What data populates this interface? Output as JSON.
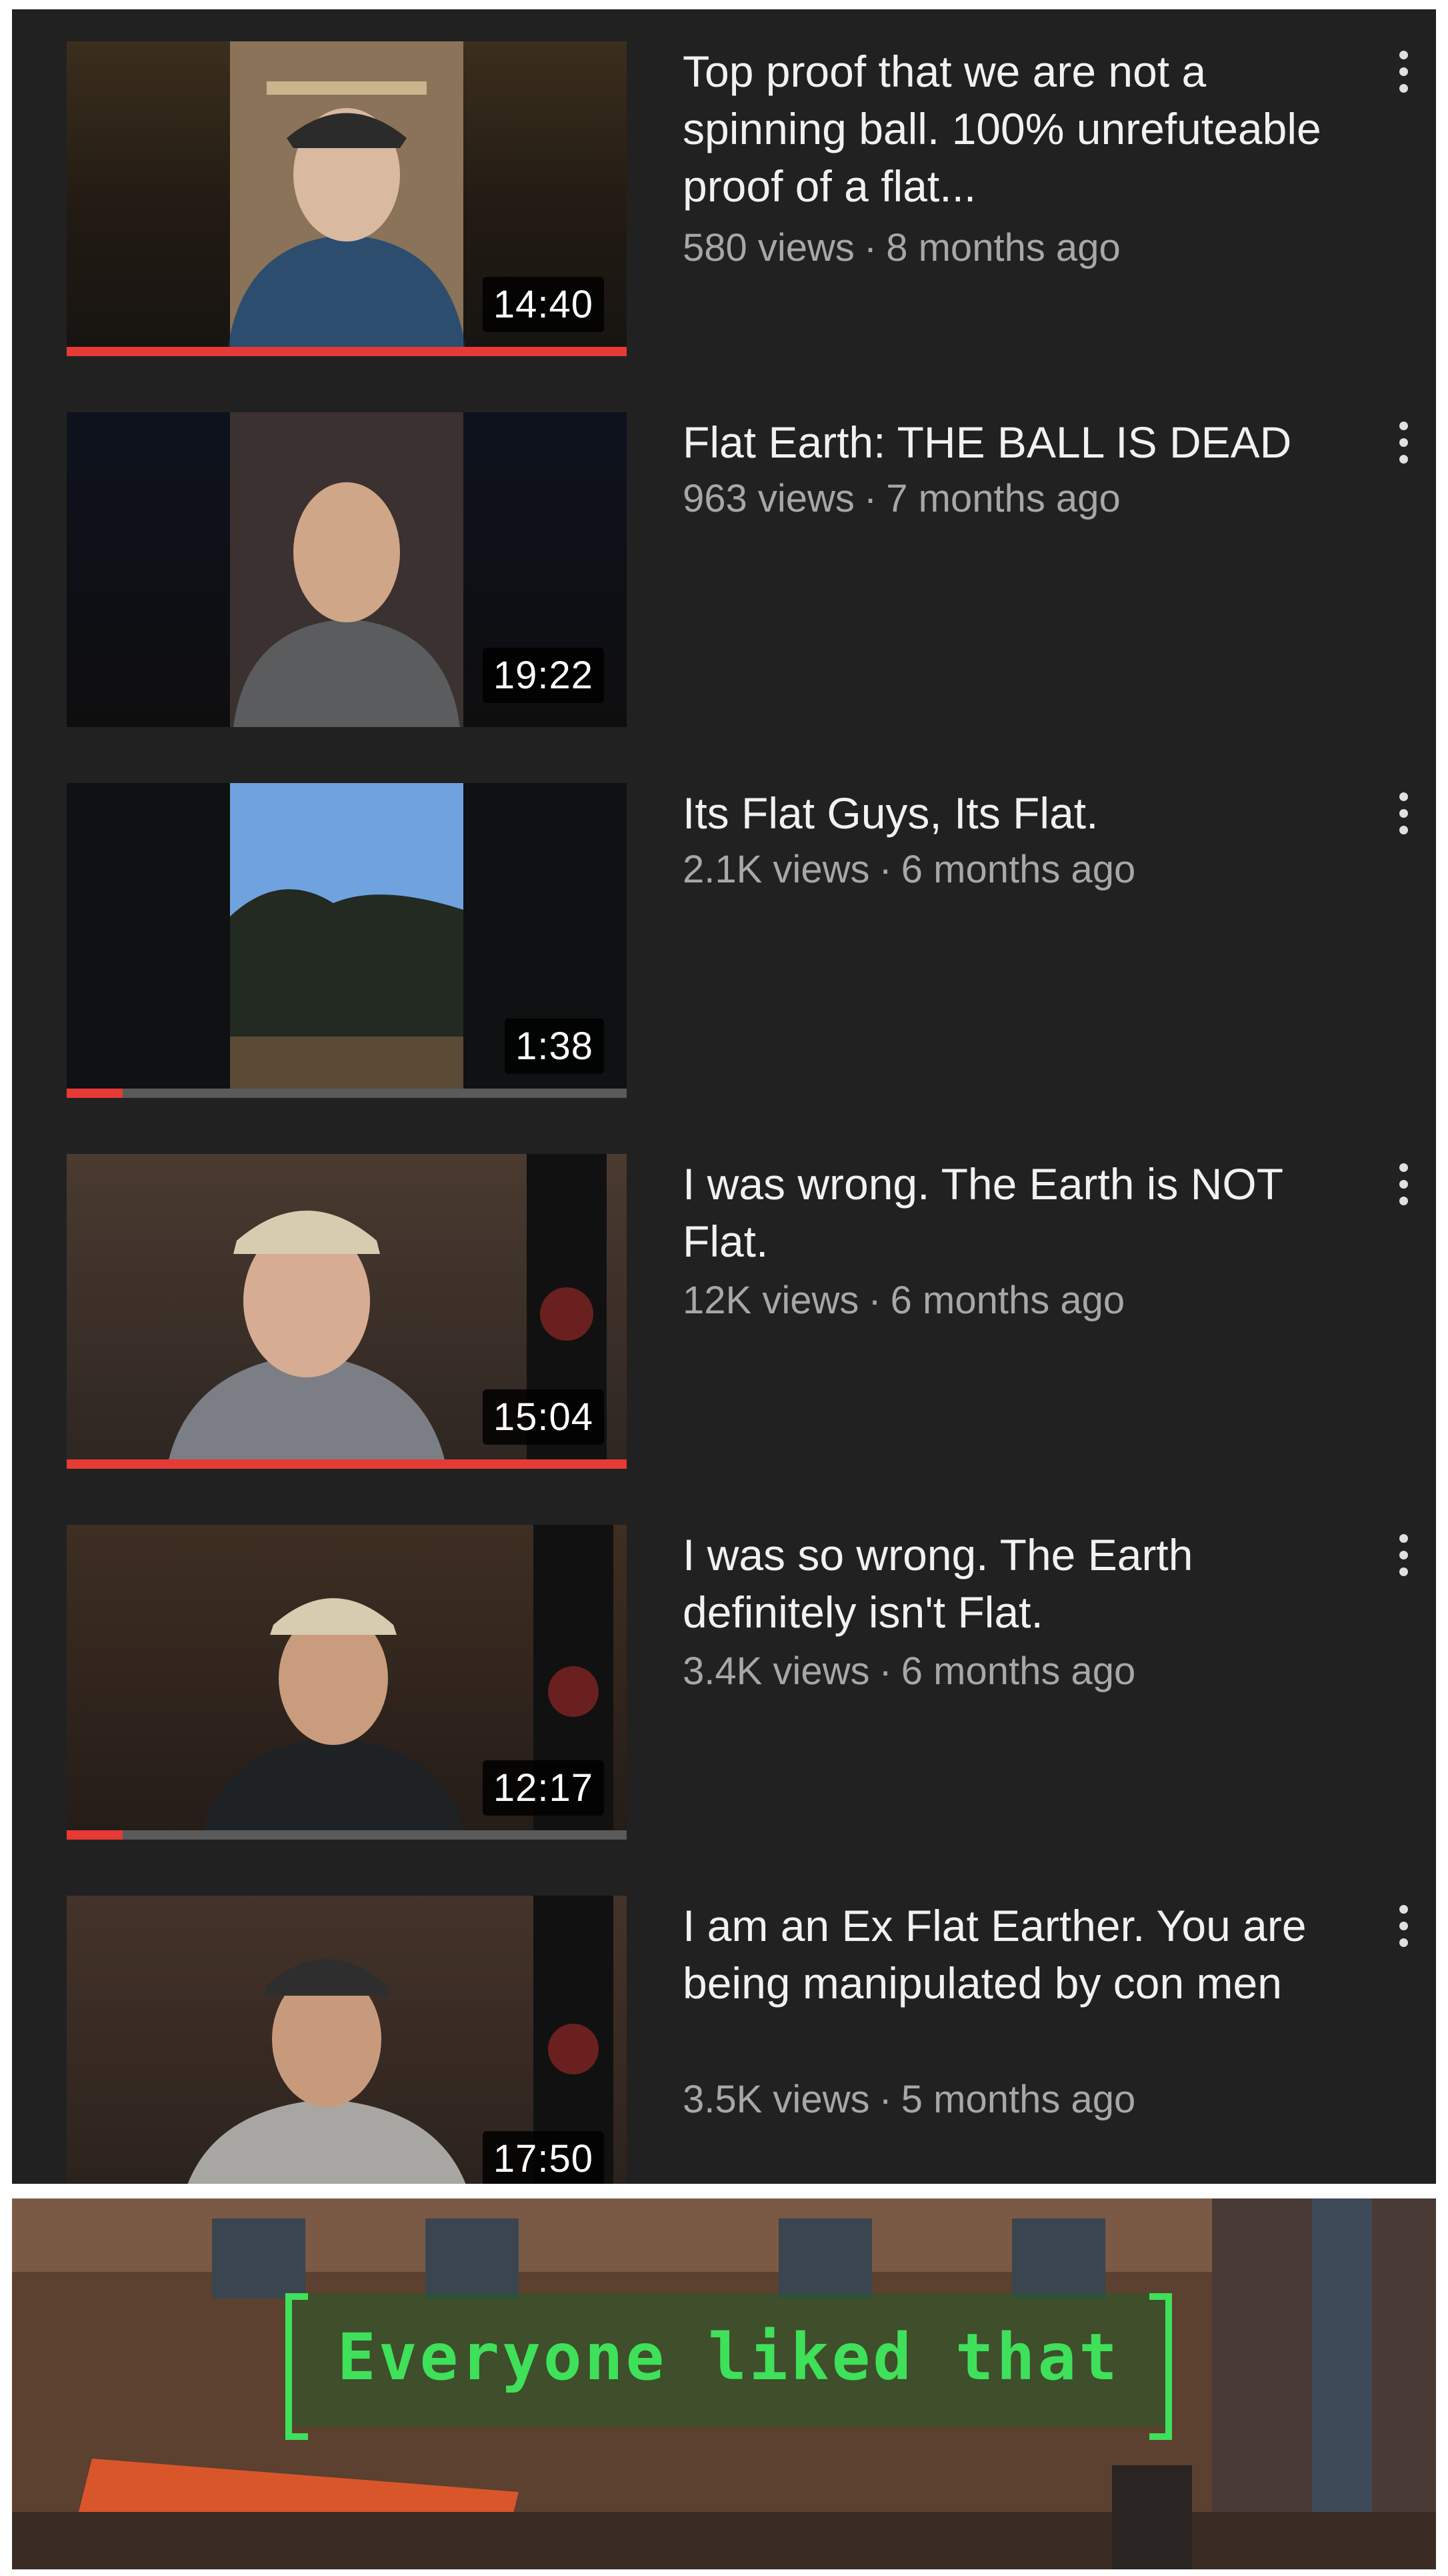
{
  "videos": [
    {
      "title": "Top proof that we are not a spinning ball. 100% unrefuteable proof of a flat...",
      "views": "580 views",
      "age": "8 months ago",
      "duration": "14:40",
      "progress": 1.0
    },
    {
      "title": "Flat Earth: THE BALL IS DEAD",
      "views": "963 views",
      "age": "7 months ago",
      "duration": "19:22",
      "progress": 0
    },
    {
      "title": "Its Flat Guys, Its Flat.",
      "views": "2.1K views",
      "age": "6 months ago",
      "duration": "1:38",
      "progress": 0.1
    },
    {
      "title": "I was wrong. The Earth is NOT Flat.",
      "views": "12K views",
      "age": "6 months ago",
      "duration": "15:04",
      "progress": 1.0
    },
    {
      "title": "I was so wrong. The Earth definitely isn't Flat.",
      "views": "3.4K views",
      "age": "6 months ago",
      "duration": "12:17",
      "progress": 0.1
    },
    {
      "title": "I am an Ex Flat Earther. You are being manipulated by con men",
      "views": "3.5K views",
      "age": "5 months ago",
      "duration": "17:50",
      "progress": 0
    }
  ],
  "meta_separator": "·",
  "caption": "Everyone liked that",
  "colors": {
    "background": "#212121",
    "progress_red": "#e53a35",
    "caption_green": "#3fe05a"
  }
}
